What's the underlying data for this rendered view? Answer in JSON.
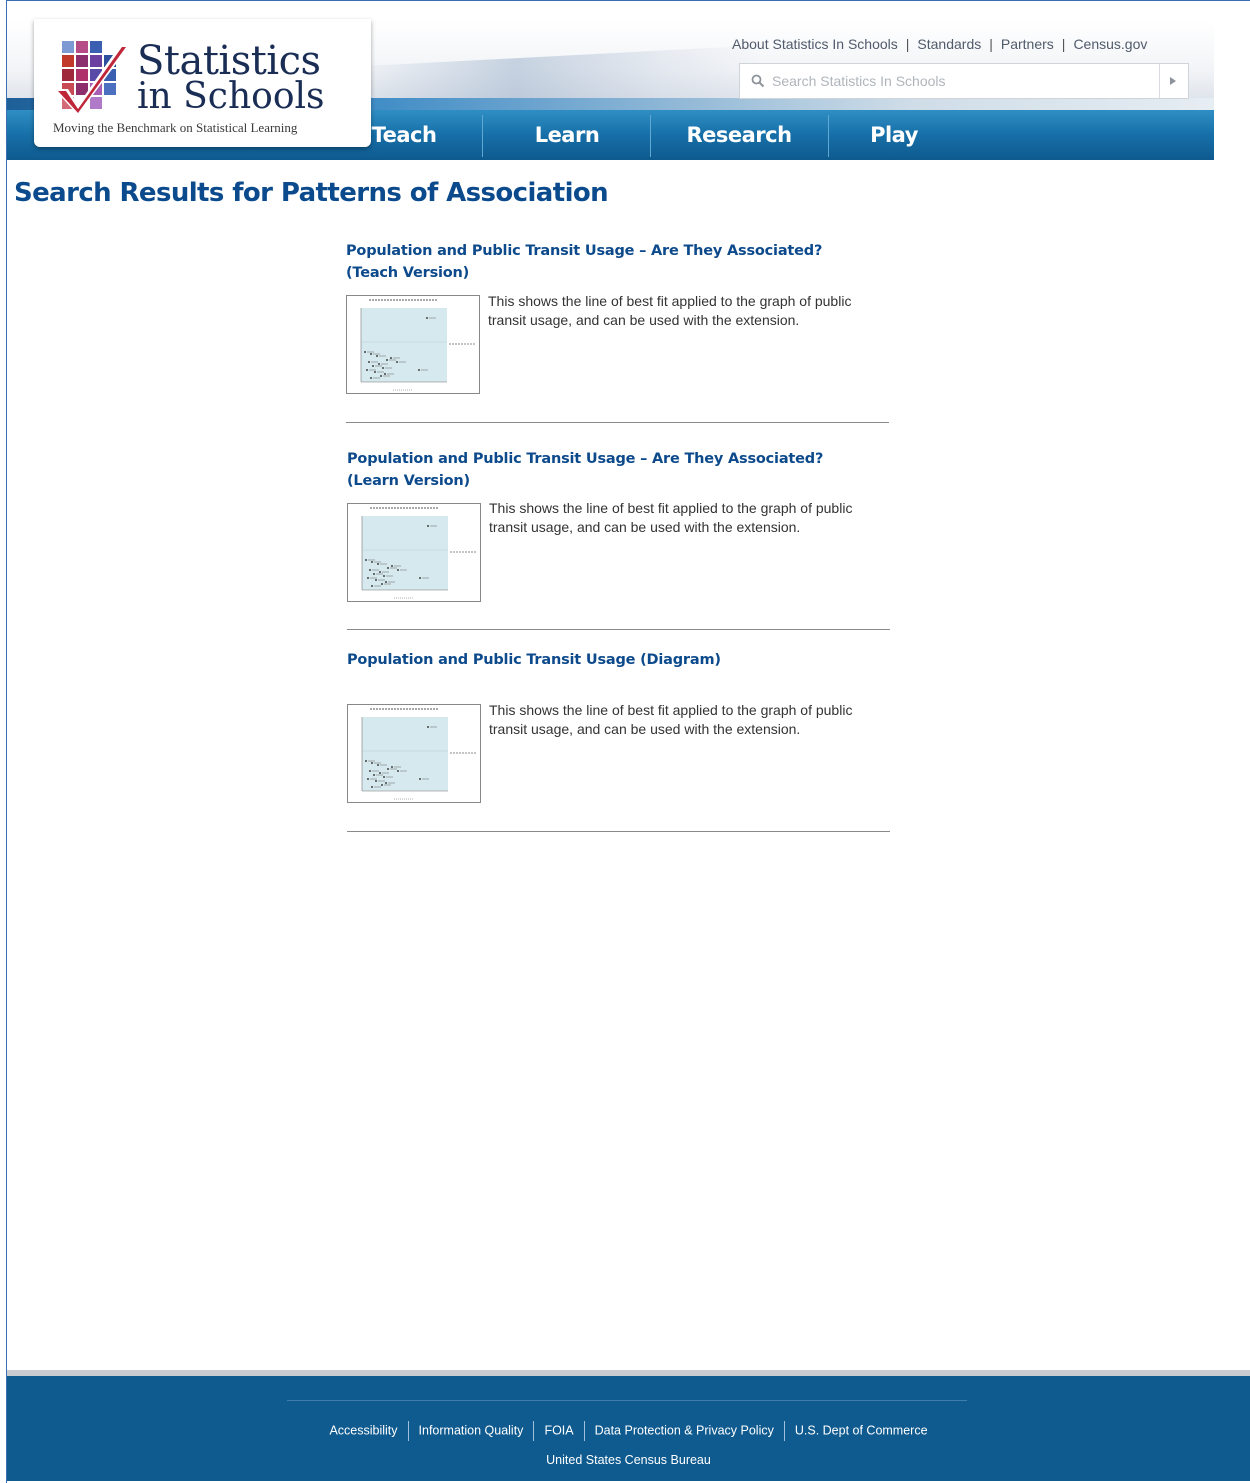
{
  "header": {
    "logo": {
      "title_line1": "Statistics",
      "title_line2": "in Schools",
      "tagline": "Moving the Benchmark on Statistical Learning",
      "colors": [
        "#1a2d54",
        "#c0392b",
        "#7b3f9e",
        "#3b5fb0"
      ]
    },
    "top_links": [
      "About Statistics In Schools",
      "Standards",
      "Partners",
      "Census.gov"
    ],
    "search": {
      "placeholder": "Search Statistics In Schools",
      "value": ""
    },
    "nav": [
      "Teach",
      "Learn",
      "Research",
      "Play"
    ]
  },
  "main": {
    "title": "Search Results for Patterns of Association",
    "results": [
      {
        "title": "Population and Public Transit Usage – Are They Associated? (Teach Version)",
        "description": "This shows the line of best fit applied to the graph of public transit usage, and can be used with the extension."
      },
      {
        "title": "Population and Public Transit Usage – Are They Associated? (Learn Version)",
        "description": "This shows the line of best fit applied to the graph of public transit usage, and can be used with the extension."
      },
      {
        "title": "Population and Public Transit Usage (Diagram)",
        "description": "This shows the line of best fit applied to the graph of public transit usage, and can be used with the extension."
      }
    ]
  },
  "footer": {
    "links": [
      "Accessibility",
      "Information Quality",
      "FOIA",
      "Data Protection & Privacy Policy",
      "U.S. Dept of Commerce"
    ],
    "subtitle": "United States Census Bureau"
  },
  "colors": {
    "nav_blue": "#176fa8",
    "title_blue": "#0b4a8c",
    "footer_blue": "#0f5a8f"
  }
}
